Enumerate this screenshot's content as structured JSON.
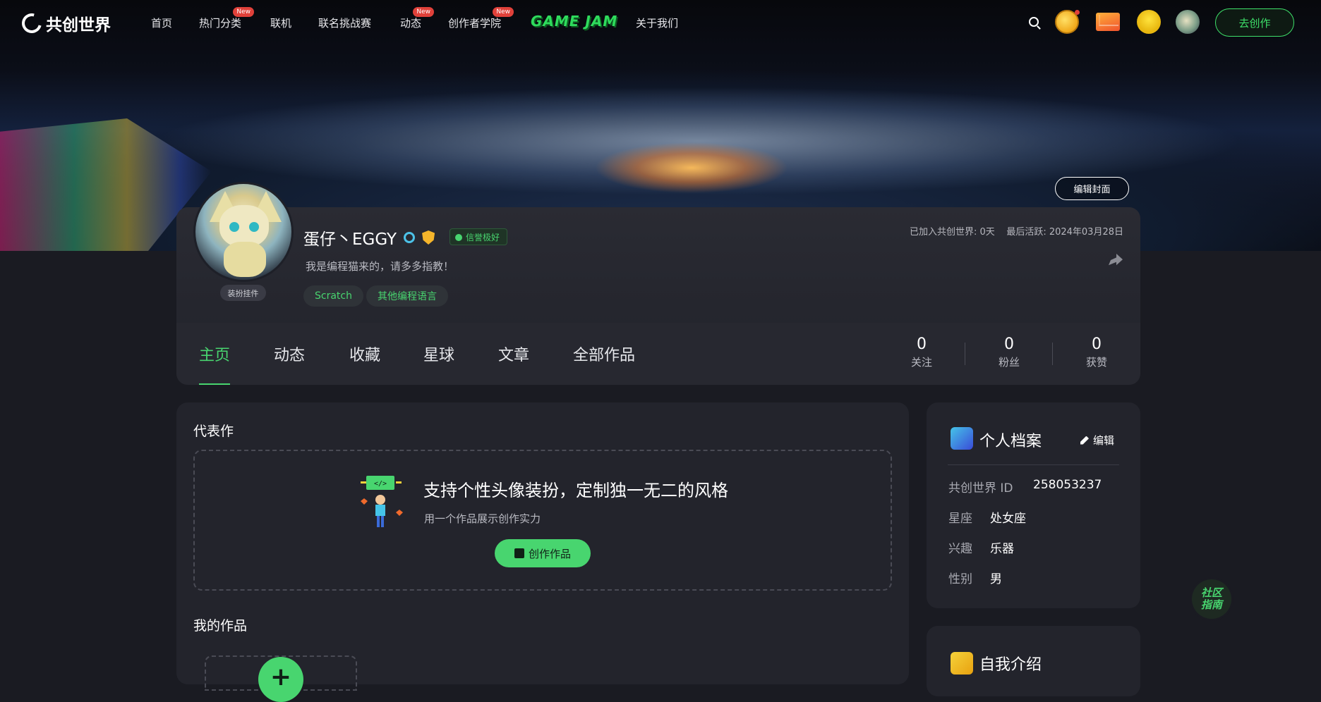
{
  "nav": {
    "logo": "共创世界",
    "items": [
      {
        "label": "首页",
        "badge": ""
      },
      {
        "label": "热门分类",
        "badge": "New"
      },
      {
        "label": "联机",
        "badge": ""
      },
      {
        "label": "联名挑战赛",
        "badge": ""
      },
      {
        "label": "动态",
        "badge": "New"
      },
      {
        "label": "创作者学院",
        "badge": "New"
      },
      {
        "label": "关于我们",
        "badge": ""
      }
    ],
    "gamejam": "GAME JAM",
    "create_button": "去创作"
  },
  "banner": {
    "edit_cover": "编辑封面"
  },
  "profile": {
    "dress_tag": "装扮挂件",
    "username": "蛋仔丶EGGY",
    "credit": "信誉极好",
    "bio": "我是编程猫来的，请多多指教！",
    "tags": [
      "Scratch",
      "其他编程语言"
    ],
    "joined": "已加入共创世界: 0天",
    "last_active": "最后活跃: 2024年03月28日",
    "tabs": [
      "主页",
      "动态",
      "收藏",
      "星球",
      "文章",
      "全部作品"
    ],
    "active_tab": "主页",
    "stats": [
      {
        "num": "0",
        "label": "关注"
      },
      {
        "num": "0",
        "label": "粉丝"
      },
      {
        "num": "0",
        "label": "获赞"
      }
    ]
  },
  "main": {
    "rep_title": "代表作",
    "promo_title": "支持个性头像装扮，定制独一无二的风格",
    "promo_sub": "用一个作品展示创作实力",
    "promo_button": "创作作品",
    "works_title": "我的作品",
    "plus": "+"
  },
  "side": {
    "profile_title": "个人档案",
    "edit": "编辑",
    "fields": [
      {
        "k": "共创世界 ID",
        "v": "258053237"
      },
      {
        "k": "星座",
        "v": "处女座"
      },
      {
        "k": "兴趣",
        "v": "乐器"
      },
      {
        "k": "性别",
        "v": "男"
      }
    ],
    "intro_title": "自我介绍"
  },
  "guide": {
    "line1": "社区",
    "line2": "指南"
  }
}
